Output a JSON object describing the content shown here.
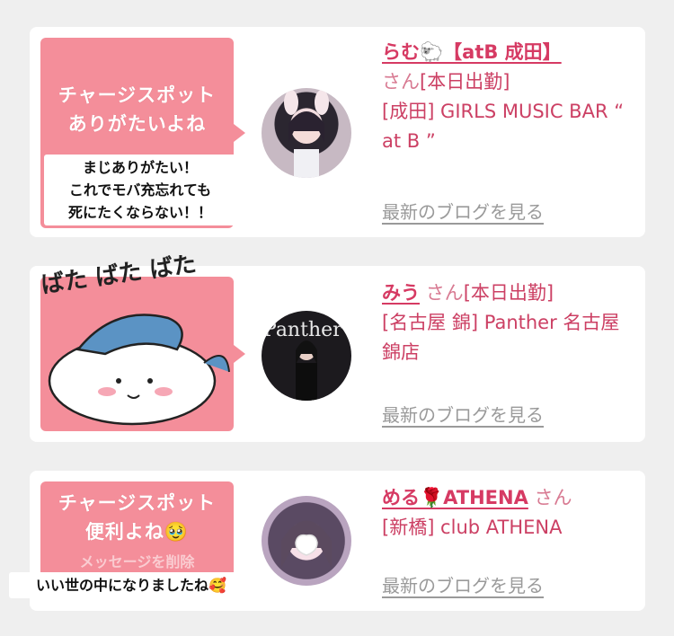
{
  "cards": [
    {
      "bubble_title_line1": "チャージスポット",
      "bubble_title_line2": "ありがたいよね",
      "overlay_line1": "まじありがたい！",
      "overlay_line2": "これでモバ充忘れても",
      "overlay_line3": "死にたくならない！！",
      "name": "らむ🐑【atB 成田】",
      "san": "さん",
      "status": "[本日出勤]",
      "shop": "[成田] GIRLS MUSIC BAR “ at B ”",
      "blog_link": "最新のブログを見る"
    },
    {
      "sticker_text": "ばた ばた ばた",
      "sticker_icon": "hachiware-character-sticker",
      "avatar_text": "Panther",
      "name": "みう",
      "san": "さん",
      "status": "[本日出勤]",
      "shop": "[名古屋 錦] Panther 名古屋錦店",
      "blog_link": "最新のブログを見る"
    },
    {
      "bubble_title_line1": "チャージスポット",
      "bubble_title_line2": "便利よね🥹",
      "bubble_hidden": "メッセージを削除",
      "overlay_line1": "いい世の中になりましたね🥰",
      "name": "める🌹ATHENA",
      "san": "さん",
      "shop": "[新橋] club ATHENA",
      "blog_link": "最新のブログを見る"
    }
  ],
  "colors": {
    "accent": "#d63a63",
    "bubble": "#f48e9a",
    "link_gray": "#9a9a9a",
    "background": "#efefef"
  }
}
